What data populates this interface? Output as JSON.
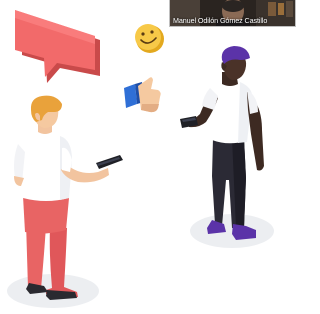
{
  "video_tile": {
    "participant_name": "Manuel Odilón Gómez Castillo"
  },
  "illustration": {
    "icons": [
      "speech-bubble-icon",
      "smiley-emoji-icon",
      "thumbs-up-icon"
    ],
    "colors": {
      "bubble": "#f26a6a",
      "emoji": "#f7c948",
      "thumb_cuff": "#2f6fd6",
      "left_person_pants": "#e86464",
      "left_person_hair": "#e9a23b",
      "right_person_cap": "#5b33a8",
      "right_person_pants": "#2b2a35",
      "shirt": "#ffffff",
      "floor_shadow": "#eceef1"
    }
  }
}
